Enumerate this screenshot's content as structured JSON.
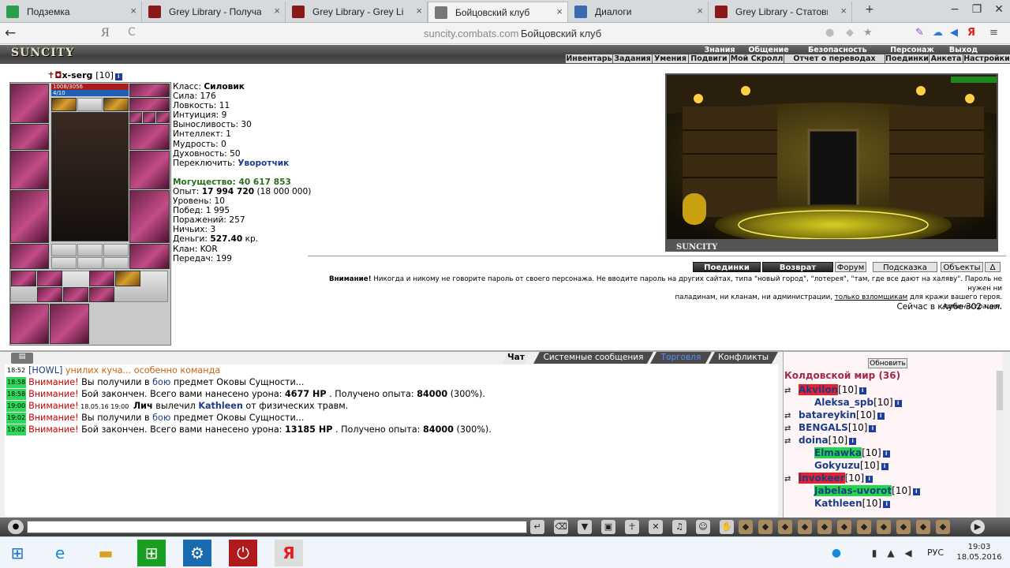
{
  "tabs": [
    {
      "label": "Подземка",
      "active": false
    },
    {
      "label": "Grey Library - Получаемый с",
      "active": false
    },
    {
      "label": "Grey Library - Grey Library - E",
      "active": false
    },
    {
      "label": "Бойцовский клуб",
      "active": true
    },
    {
      "label": "Диалоги",
      "active": false
    },
    {
      "label": "Grey Library - Статовые бону",
      "active": false
    }
  ],
  "newtab": "+",
  "window_controls": [
    "−",
    "❐",
    "✕"
  ],
  "address": {
    "back": "←",
    "search_engine": "Я",
    "reload": "C",
    "url": "suncity.combats.com",
    "title": "Бойцовский клуб"
  },
  "game": {
    "logo": "SUNCITY",
    "menu_top": [
      "Знания",
      "Общение",
      "Безопасность",
      "Персонаж",
      "Выход"
    ],
    "menu_sub": [
      "Инвентарь",
      "Задания",
      "Умения",
      "Подвиги",
      "Мой Скролл",
      "Отчет о переводах",
      "Поединки",
      "Анкета",
      "Настройки"
    ]
  },
  "character": {
    "nick": "x-serg",
    "level": "[10]",
    "hp": "1008/3056",
    "mp": "4/10",
    "stats": {
      "class_label": "Класс:",
      "class": "Силовик",
      "lines": [
        "Сила: 176",
        "Ловкость: 11",
        "Интуиция: 9",
        "Выносливость: 30",
        "Интеллект: 1",
        "Мудрость: 0",
        "Духовность: 50"
      ],
      "switch_label": "Переключить:",
      "switch": "Уворотчик",
      "power": "Могущество: 40 617 853",
      "exp_label": "Опыт:",
      "exp": "17 994 720",
      "exp_next": "(18 000 000)",
      "lines2": [
        "Уровень: 10",
        "Побед: 1 995",
        "Поражений: 257",
        "Ничьих: 3"
      ],
      "money_label": "Деньги:",
      "money": "527.40",
      "money_unit": "кр.",
      "clan": "Клан: KOR",
      "transfers": "Передач: 199"
    }
  },
  "room": {
    "logo": "SUNCITY"
  },
  "buttons": {
    "duels": "Поединки",
    "return": "Возврат",
    "forum": "Форум",
    "hint": "Подсказка",
    "objects": "Объекты",
    "delta": "Δ"
  },
  "warning": {
    "bold": "Внимание!",
    "text": "Никогда и никому не говорите пароль от своего персонажа. Не вводите пароль на других сайтах, типа \"новый город\", \"лотерея\", \"там, где все дают на халяву\". Пароль не нужен ни",
    "text2a": "паладинам, ни кланам, ни администрации,",
    "link": "только взломщикам",
    "text2b": "для кражи вашего героя.",
    "sign": "Администрация."
  },
  "online": "Сейчас в клубе 302 чел.",
  "chat_tabs": [
    {
      "label": "Чат",
      "active": true
    },
    {
      "label": "Системные сообщения",
      "active": false
    },
    {
      "label": "Торговля",
      "active": false
    },
    {
      "label": "Конфликты",
      "active": false
    }
  ],
  "chat": [
    {
      "time": "18:52",
      "parts": [
        [
          "howl",
          "[HOWL]"
        ],
        [
          "orange",
          " унилих куча... особенно команда"
        ]
      ]
    },
    {
      "time": "18:58",
      "green": true,
      "parts": [
        [
          "red",
          "Внимание!"
        ],
        [
          "",
          " Вы получили в "
        ],
        [
          "blue",
          "бою"
        ],
        [
          "",
          " предмет Оковы Сущности..."
        ]
      ]
    },
    {
      "time": "18:58",
      "green": true,
      "parts": [
        [
          "red",
          "Внимание!"
        ],
        [
          "",
          " Бой закончен. Всего вами нанесено урона: "
        ],
        [
          "b",
          "4677 HP"
        ],
        [
          "",
          " . Получено опыта: "
        ],
        [
          "b",
          "84000"
        ],
        [
          "",
          " (300%)."
        ]
      ]
    },
    {
      "time": "19:00",
      "green": true,
      "parts": [
        [
          "red",
          "Внимание!"
        ],
        [
          "tp",
          " 18.05.16 19:00 "
        ],
        [
          "b",
          " Лич"
        ],
        [
          "",
          " вылечил "
        ],
        [
          "blueb",
          "Kathleen"
        ],
        [
          "",
          " от физических травм."
        ]
      ]
    },
    {
      "time": "19:02",
      "green": true,
      "parts": [
        [
          "red",
          "Внимание!"
        ],
        [
          "",
          " Вы получили в "
        ],
        [
          "blue",
          "бою"
        ],
        [
          "",
          " предмет Оковы Сущности..."
        ]
      ]
    },
    {
      "time": "19:02",
      "green": true,
      "parts": [
        [
          "red",
          "Внимание!"
        ],
        [
          "",
          " Бой закончен. Всего вами нанесено урона: "
        ],
        [
          "b",
          "13185 HP"
        ],
        [
          "",
          " . Получено опыта: "
        ],
        [
          "b",
          "84000"
        ],
        [
          "",
          " (300%)."
        ]
      ]
    }
  ],
  "userlist": {
    "update": "Обновить",
    "world": "Колдовской мир (36)",
    "users": [
      {
        "name": "Akvilon",
        "level": "[10]",
        "hl": "r",
        "indent": 0
      },
      {
        "name": "Aleksa_spb",
        "level": "[10]",
        "hl": "",
        "indent": 1
      },
      {
        "name": "batareykin",
        "level": "[10]",
        "hl": "",
        "indent": 0
      },
      {
        "name": "BENGALS",
        "level": "[10]",
        "hl": "",
        "indent": 0
      },
      {
        "name": "doina",
        "level": "[10]",
        "hl": "",
        "indent": 0
      },
      {
        "name": "Elmawka",
        "level": "[10]",
        "hl": "g",
        "indent": 1
      },
      {
        "name": "Gokyuzu",
        "level": "[10]",
        "hl": "",
        "indent": 1
      },
      {
        "name": "invokeer",
        "level": "[10]",
        "hl": "r",
        "indent": 0
      },
      {
        "name": "Jabelas-uvorot",
        "level": "[10]",
        "hl": "g",
        "indent": 1
      },
      {
        "name": "Kathleen",
        "level": "[10]",
        "hl": "",
        "indent": 1
      }
    ]
  },
  "taskbar": {
    "lang": "РУС",
    "time": "19:03",
    "date": "18.05.2016"
  }
}
